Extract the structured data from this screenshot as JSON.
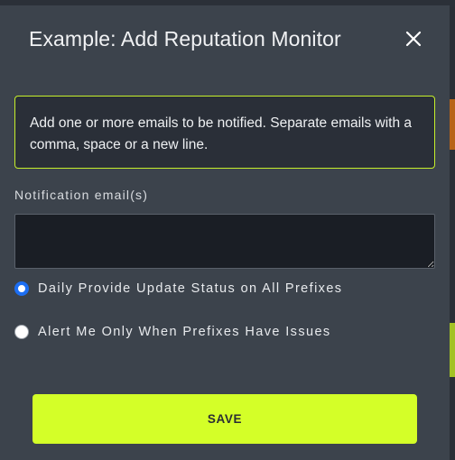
{
  "modal": {
    "title": "Example: Add Reputation Monitor",
    "close_icon": "close-icon",
    "info_text": "Add one or more emails to be notified. Separate emails with a comma, space or a new line.",
    "email_field": {
      "label": "Notification email(s)",
      "value": "",
      "placeholder": ""
    },
    "radio_options": [
      {
        "label": "Daily Provide Update Status on All Prefixes",
        "selected": true
      },
      {
        "label": "Alert Me Only When Prefixes Have Issues",
        "selected": false
      }
    ],
    "save_label": "SAVE"
  },
  "colors": {
    "accent": "#d4ff28",
    "info_border": "#c6ef2a",
    "radio_selected": "#1c6ef2",
    "modal_bg": "#3c434c",
    "backdrop_orange": "#b86418",
    "backdrop_lime": "#a3c224"
  }
}
